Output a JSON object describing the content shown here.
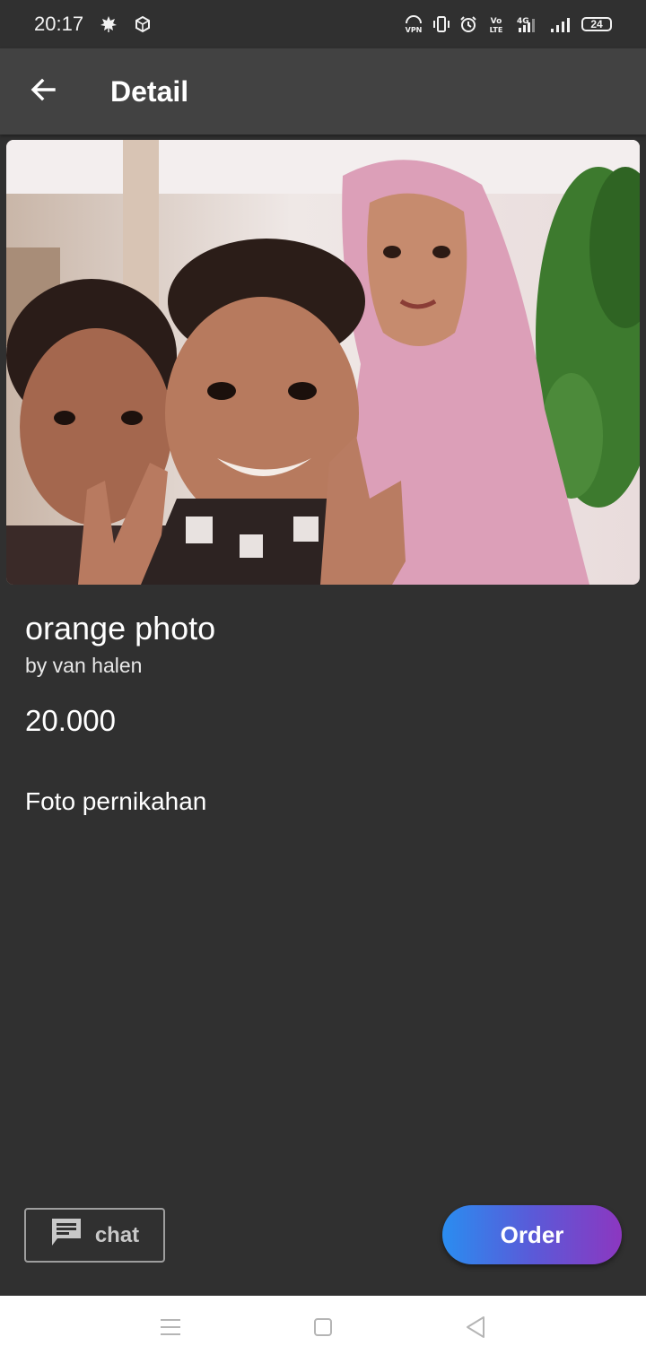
{
  "status_bar": {
    "time": "20:17",
    "left_icons": [
      "maple-leaf-icon",
      "cube-icon"
    ],
    "right_icons": [
      "vpn-icon",
      "vibrate-icon",
      "alarm-icon",
      "volte-icon",
      "4g-signal-icon",
      "signal-icon"
    ],
    "battery_level": "24"
  },
  "app_bar": {
    "back_icon": "arrow-left-icon",
    "title": "Detail"
  },
  "item": {
    "title": "orange photo",
    "author": "by van halen",
    "price": "20.000",
    "description": "Foto pernikahan"
  },
  "actions": {
    "chat_icon": "message-icon",
    "chat_label": "chat",
    "order_label": "Order"
  },
  "colors": {
    "background": "#303030",
    "app_bar": "#424242",
    "order_gradient_start": "#2a8df0",
    "order_gradient_end": "#8c37c0"
  },
  "nav_bar": {
    "icons": [
      "menu-icon",
      "home-square-icon",
      "back-triangle-icon"
    ]
  }
}
